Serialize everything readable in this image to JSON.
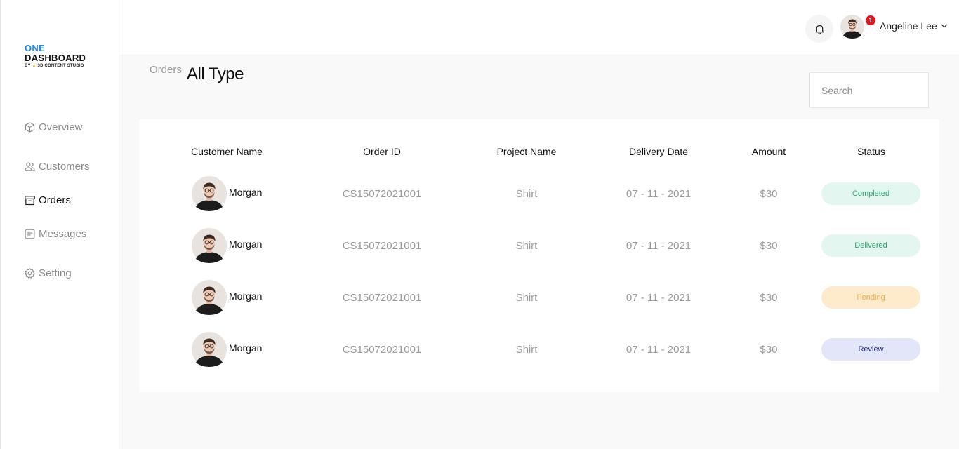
{
  "brand": {
    "line1": "ONE",
    "line2": "DASHBOARD",
    "line3_prefix": "BY",
    "line3_name": "3D CONTENT STUDIO"
  },
  "sidebar": {
    "items": [
      {
        "label": "Overview",
        "icon": "cube-icon",
        "active": false
      },
      {
        "label": "Customers",
        "icon": "users-icon",
        "active": false
      },
      {
        "label": "Orders",
        "icon": "archive-icon",
        "active": true
      },
      {
        "label": "Messages",
        "icon": "message-icon",
        "active": false
      },
      {
        "label": "Setting",
        "icon": "gear-icon",
        "active": false
      }
    ]
  },
  "header": {
    "notification_count": "1",
    "user_name": "Angeline Lee"
  },
  "page": {
    "breadcrumb": "Orders",
    "title": "All Type"
  },
  "search": {
    "placeholder": "Search"
  },
  "table": {
    "columns": [
      "Customer Name",
      "Order ID",
      "Project Name",
      "Delivery Date",
      "Amount",
      "Status"
    ],
    "rows": [
      {
        "name": "Morgan",
        "order_id": "CS15072021001",
        "project": "Shirt",
        "date": "07 - 11 - 2021",
        "amount": "$30",
        "status": "Completed"
      },
      {
        "name": "Morgan",
        "order_id": "CS15072021001",
        "project": "Shirt",
        "date": "07 - 11 - 2021",
        "amount": "$30",
        "status": "Delivered"
      },
      {
        "name": "Morgan",
        "order_id": "CS15072021001",
        "project": "Shirt",
        "date": "07 - 11 - 2021",
        "amount": "$30",
        "status": "Pending"
      },
      {
        "name": "Morgan",
        "order_id": "CS15072021001",
        "project": "Shirt",
        "date": "07 - 11 - 2021",
        "amount": "$30",
        "status": "Review"
      }
    ]
  },
  "colors": {
    "brand_blue": "#1e88e5",
    "badge_red": "#e8141b",
    "status": {
      "Completed": {
        "bg": "#e3f6ef",
        "fg": "#23a96b"
      },
      "Delivered": {
        "bg": "#e3f6ef",
        "fg": "#23a96b"
      },
      "Pending": {
        "bg": "#fdebcb",
        "fg": "#f2a94a"
      },
      "Review": {
        "bg": "#e3e5f8",
        "fg": "#1f2a8a"
      }
    }
  }
}
